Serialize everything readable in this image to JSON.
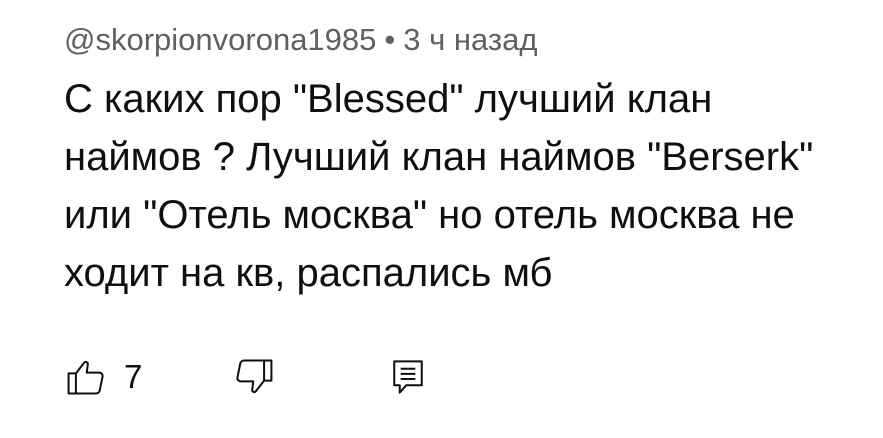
{
  "comment": {
    "author": "@skorpionvorona1985",
    "separator": "•",
    "time": "3 ч назад",
    "text_lines": [
      "С каких пор \"Blessed\" лучший клан",
      "наймов ? Лучший клан наймов \"Berserk\"",
      "или \"Отель москва\" но отель москва не",
      "ходит на кв, распались мб"
    ],
    "like_count": "7",
    "icons": {
      "like": "thumb-up-icon",
      "dislike": "thumb-down-icon",
      "reply": "reply-comment-icon"
    },
    "colors": {
      "meta": "#606060",
      "text": "#0f0f0f",
      "background": "#ffffff"
    }
  }
}
